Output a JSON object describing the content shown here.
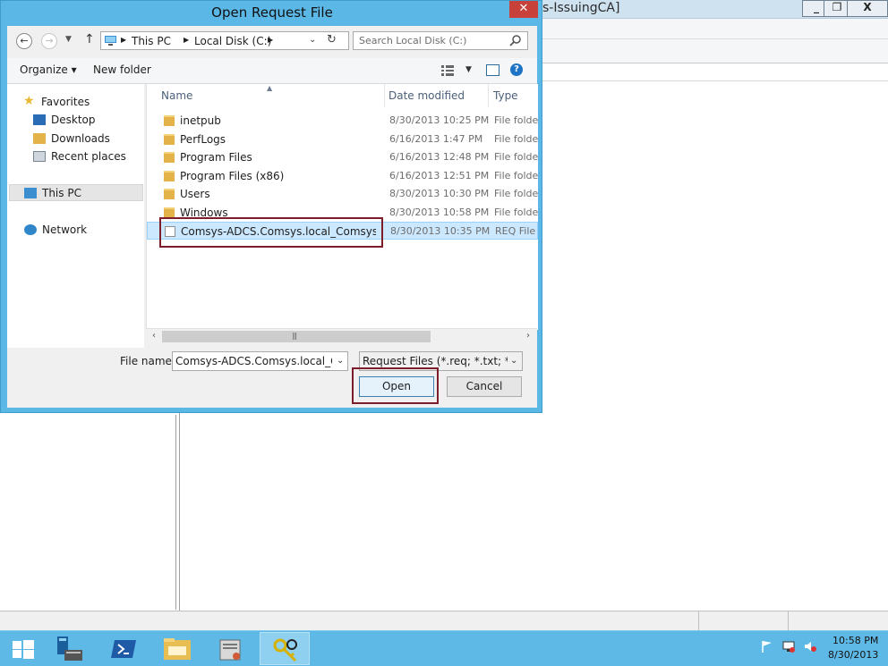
{
  "background_window": {
    "title": "s-IssuingCA]",
    "controls": {
      "minimize": "_",
      "restore": "❐",
      "close": "X"
    }
  },
  "dialog": {
    "title": "Open Request File",
    "close": "✕",
    "address": {
      "crumbs": [
        "This PC",
        "Local Disk (C:)"
      ],
      "search_placeholder": "Search Local Disk (C:)"
    },
    "toolbar": {
      "organize": "Organize ▾",
      "new_folder": "New folder",
      "help": "?"
    },
    "nav": {
      "favorites": "Favorites",
      "desktop": "Desktop",
      "downloads": "Downloads",
      "recent": "Recent places",
      "this_pc": "This PC",
      "network": "Network"
    },
    "columns": {
      "name": "Name",
      "date": "Date modified",
      "type": "Type"
    },
    "files": [
      {
        "name": "inetpub",
        "date": "8/30/2013 10:25 PM",
        "type": "File folder",
        "kind": "folder-icon"
      },
      {
        "name": "PerfLogs",
        "date": "6/16/2013 1:47 PM",
        "type": "File folder",
        "kind": "folder-icon"
      },
      {
        "name": "Program Files",
        "date": "6/16/2013 12:48 PM",
        "type": "File folder",
        "kind": "folder-icon"
      },
      {
        "name": "Program Files (x86)",
        "date": "6/16/2013 12:51 PM",
        "type": "File folder",
        "kind": "folder-icon"
      },
      {
        "name": "Users",
        "date": "8/30/2013 10:30 PM",
        "type": "File folder",
        "kind": "folder-icon"
      },
      {
        "name": "Windows",
        "date": "8/30/2013 10:58 PM",
        "type": "File folder",
        "kind": "folder-icon"
      },
      {
        "name": "Comsys-ADCS.Comsys.local_Comsys-C...",
        "date": "8/30/2013 10:35 PM",
        "type": "REQ File",
        "kind": "file-icon"
      }
    ],
    "bottom": {
      "filename_label": "File name:",
      "filename_value": "Comsys-ADCS.Comsys.local_Comsys-C",
      "filetype": "Request Files (*.req; *.txt; *.cmc",
      "open": "Open",
      "cancel": "Cancel"
    }
  },
  "taskbar": {
    "apps": [
      "server-manager-icon",
      "powershell-icon",
      "file-explorer-icon",
      "certification-authority-icon",
      "certificate-keys-icon"
    ],
    "clock": {
      "time": "10:58 PM",
      "date": "8/30/2013"
    }
  },
  "colors": {
    "dialog_frame": "#5ab7e6",
    "taskbar": "#5fb9e6",
    "selection": "#cce8ff",
    "highlight_box": "#7d1d2c"
  }
}
